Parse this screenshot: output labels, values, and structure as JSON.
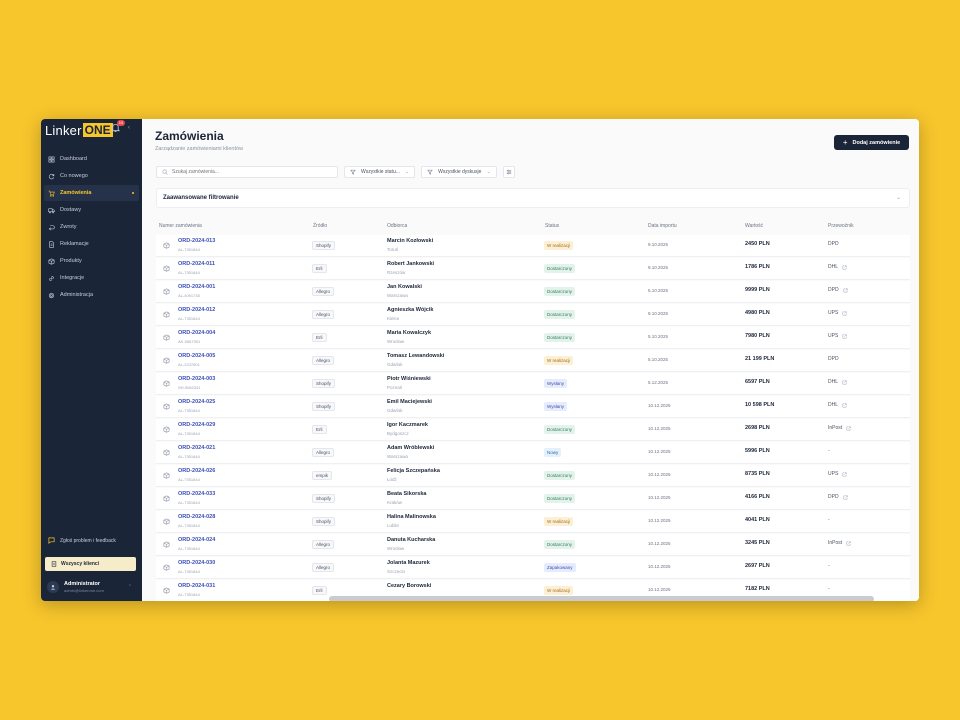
{
  "brand": {
    "name_a": "Linker",
    "name_b": "ONE",
    "notifications": "10"
  },
  "nav": [
    {
      "label": "Dashboard",
      "icon": "grid-icon",
      "active": false
    },
    {
      "label": "Co nowego",
      "icon": "refresh-icon",
      "active": false
    },
    {
      "label": "Zamówienia",
      "icon": "cart-icon",
      "active": true
    },
    {
      "label": "Dostawy",
      "icon": "truck-icon",
      "active": false
    },
    {
      "label": "Zwroty",
      "icon": "return-icon",
      "active": false
    },
    {
      "label": "Reklamacje",
      "icon": "document-icon",
      "active": false
    },
    {
      "label": "Produkty",
      "icon": "box-icon",
      "active": false
    },
    {
      "label": "Integracje",
      "icon": "link-icon",
      "active": false
    },
    {
      "label": "Administracja",
      "icon": "gear-icon",
      "active": false
    }
  ],
  "sidebar_footer": {
    "feedback": "Zgłoś problem i feedback",
    "clients": "Wszyscy klienci",
    "user_name": "Administrator",
    "user_email": "admin@linkerone.com"
  },
  "header": {
    "title": "Zamówienia",
    "subtitle": "Zarządzanie zamówieniami klientów",
    "add_button": "Dodaj zamówienie"
  },
  "toolbar": {
    "search_placeholder": "Szukaj zamówienia...",
    "status_filter": "Wszystkie statu...",
    "action_filter": "Wszystkie dyskusje"
  },
  "advanced": {
    "label": "Zaawansowane filtrowanie"
  },
  "columns": {
    "number": "Numer zamówienia",
    "source": "Źródło",
    "recipient": "Odbiorca",
    "status": "Status",
    "date": "Data importu",
    "value": "Wartość",
    "carrier": "Przewoźnik"
  },
  "colors": {
    "accent": "#f7c52c",
    "sidebar": "#1b2538",
    "link": "#3b4fb8"
  },
  "rows": [
    {
      "number": "ORD-2024-013",
      "sub": "AL-7351844",
      "source": "Shopify",
      "name": "Marcin Kozłowski",
      "city": "Toruń",
      "status": "W realizacji",
      "status_type": "pending",
      "date": "9.10.2025",
      "value": "2450 PLN",
      "carrier": "DPD",
      "link": false
    },
    {
      "number": "ORD-2024-011",
      "sub": "AL-7351844",
      "source": "Erli",
      "name": "Robert Jankowski",
      "city": "Rzeszów",
      "status": "Dostarczony",
      "status_type": "done",
      "date": "9.10.2025",
      "value": "1786 PLN",
      "carrier": "DHL",
      "link": true
    },
    {
      "number": "ORD-2024-001",
      "sub": "AL-4091735",
      "source": "Allegro",
      "name": "Jan Kowalski",
      "city": "Warszawa",
      "status": "Dostarczony",
      "status_type": "done",
      "date": "5.10.2025",
      "value": "9999 PLN",
      "carrier": "DPD",
      "link": true
    },
    {
      "number": "ORD-2024-012",
      "sub": "AL-7351844",
      "source": "Allegro",
      "name": "Agnieszka Wójcik",
      "city": "Kielce",
      "status": "Dostarczony",
      "status_type": "done",
      "date": "9.10.2025",
      "value": "4980 PLN",
      "carrier": "UPS",
      "link": true
    },
    {
      "number": "ORD-2024-004",
      "sub": "AK-5567091",
      "source": "Erli",
      "name": "Maria Kowalczyk",
      "city": "Wrocław",
      "status": "Dostarczony",
      "status_type": "done",
      "date": "5.10.2025",
      "value": "7980 PLN",
      "carrier": "UPS",
      "link": true
    },
    {
      "number": "ORD-2024-005",
      "sub": "AL-2247601",
      "source": "Allegro",
      "name": "Tomasz Lewandowski",
      "city": "Gdańsk",
      "status": "W realizacji",
      "status_type": "pending",
      "date": "5.10.2025",
      "value": "21 199 PLN",
      "carrier": "DPD",
      "link": false
    },
    {
      "number": "ORD-2024-003",
      "sub": "SH-9082341",
      "source": "Shopify",
      "name": "Piotr Wiśniewski",
      "city": "Poznań",
      "status": "Wysłany",
      "status_type": "sent",
      "date": "5.12.2025",
      "value": "6597 PLN",
      "carrier": "DHL",
      "link": true
    },
    {
      "number": "ORD-2024-025",
      "sub": "AL-7351844",
      "source": "Shopify",
      "name": "Emil Maciejewski",
      "city": "Gdańsk",
      "status": "Wysłany",
      "status_type": "sent",
      "date": "10.12.2025",
      "value": "10 598 PLN",
      "carrier": "DHL",
      "link": true
    },
    {
      "number": "ORD-2024-029",
      "sub": "AL-7351844",
      "source": "Erli",
      "name": "Igor Kaczmarek",
      "city": "Bydgoszcz",
      "status": "Dostarczony",
      "status_type": "done",
      "date": "10.12.2025",
      "value": "2698 PLN",
      "carrier": "InPost",
      "link": true
    },
    {
      "number": "ORD-2024-021",
      "sub": "AL-7351844",
      "source": "Allegro",
      "name": "Adam Wróblewski",
      "city": "Warszawa",
      "status": "Nowy",
      "status_type": "new",
      "date": "10.12.2025",
      "value": "5996 PLN",
      "carrier": "-",
      "link": false
    },
    {
      "number": "ORD-2024-026",
      "sub": "AL-7351844",
      "source": "empik",
      "name": "Felicja Szczepańska",
      "city": "Łódź",
      "status": "Dostarczony",
      "status_type": "done",
      "date": "10.12.2025",
      "value": "8735 PLN",
      "carrier": "UPS",
      "link": true
    },
    {
      "number": "ORD-2024-033",
      "sub": "AL-7351844",
      "source": "Shopify",
      "name": "Beata Sikorska",
      "city": "Kraków",
      "status": "Dostarczony",
      "status_type": "done",
      "date": "10.12.2025",
      "value": "4166 PLN",
      "carrier": "DPD",
      "link": true
    },
    {
      "number": "ORD-2024-028",
      "sub": "AL-7351844",
      "source": "Shopify",
      "name": "Halina Malinowska",
      "city": "Lublin",
      "status": "W realizacji",
      "status_type": "pending",
      "date": "10.12.2025",
      "value": "4041 PLN",
      "carrier": "-",
      "link": false
    },
    {
      "number": "ORD-2024-024",
      "sub": "AL-7351844",
      "source": "Allegro",
      "name": "Danuta Kucharska",
      "city": "Wrocław",
      "status": "Dostarczony",
      "status_type": "done",
      "date": "10.12.2025",
      "value": "3245 PLN",
      "carrier": "InPost",
      "link": true
    },
    {
      "number": "ORD-2024-030",
      "sub": "AL-7351844",
      "source": "Allegro",
      "name": "Jolanta Mazurek",
      "city": "Szczecin",
      "status": "Zapakowany",
      "status_type": "sent",
      "date": "10.12.2025",
      "value": "2697 PLN",
      "carrier": "-",
      "link": false
    },
    {
      "number": "ORD-2024-031",
      "sub": "AL-7351844",
      "source": "Erli",
      "name": "Cezary Borowski",
      "city": "",
      "status": "W realizacji",
      "status_type": "pending",
      "date": "10.12.2025",
      "value": "7182 PLN",
      "carrier": "-",
      "link": false
    }
  ]
}
